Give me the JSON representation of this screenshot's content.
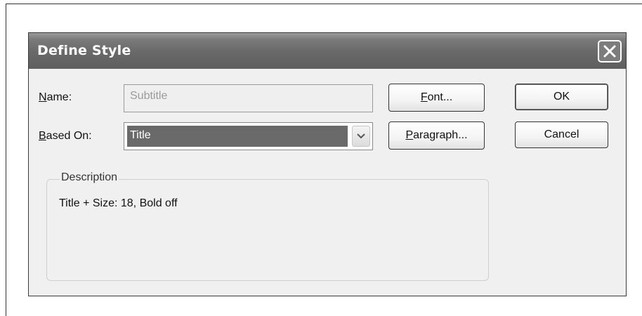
{
  "dialog": {
    "title": "Define Style"
  },
  "form": {
    "name_label_key": "N",
    "name_label_rest": "ame:",
    "name_value": "Subtitle",
    "based_on_label_key": "B",
    "based_on_label_rest": "ased On:",
    "based_on_value": "Title"
  },
  "buttons": {
    "font_key": "F",
    "font_rest": "ont...",
    "paragraph_key": "P",
    "paragraph_rest": "aragraph...",
    "ok": "OK",
    "cancel": "Cancel"
  },
  "description": {
    "legend": "Description",
    "text": "Title + Size: 18, Bold off"
  },
  "icons": {
    "close": "close-icon",
    "dropdown": "chevron-down-icon"
  },
  "colors": {
    "titlebar": "#6a6a6a",
    "selection": "#6a6a6a",
    "dialog_bg": "#f0f0f0"
  }
}
